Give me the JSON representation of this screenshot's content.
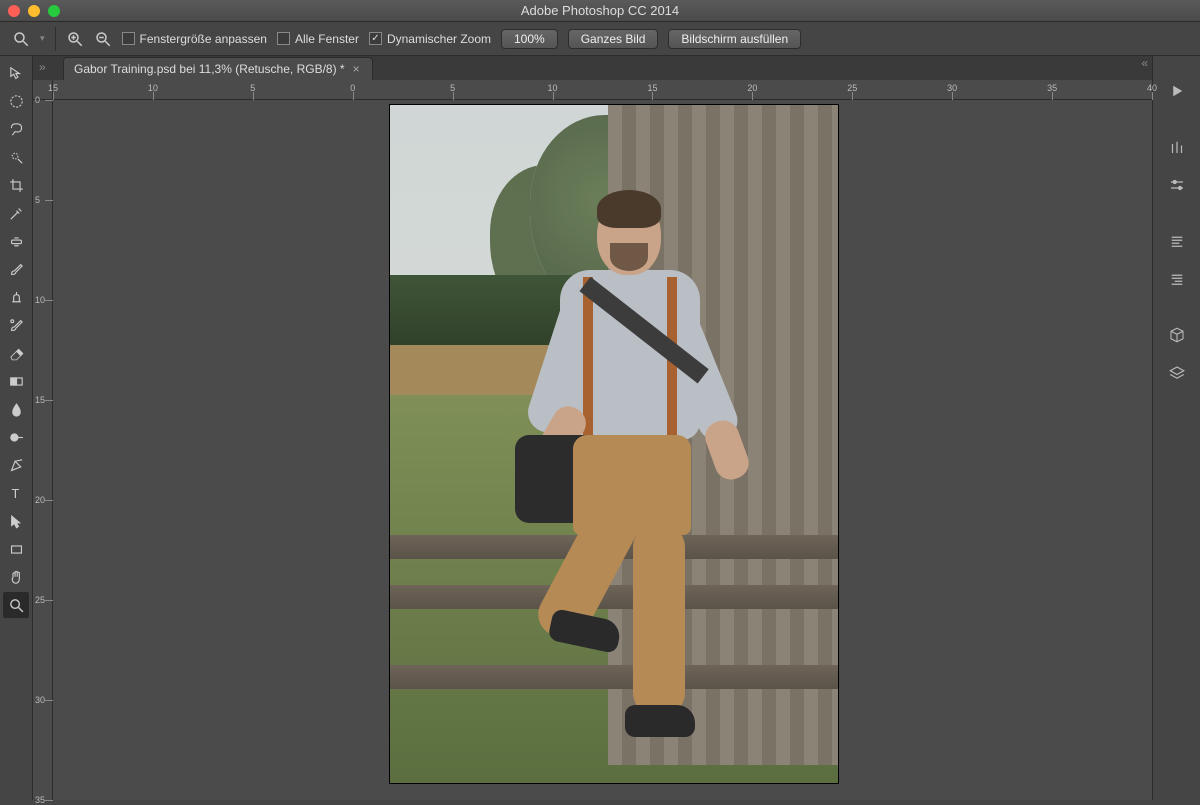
{
  "app_title": "Adobe Photoshop CC 2014",
  "optbar": {
    "fit_window": "Fenstergröße anpassen",
    "all_windows": "Alle Fenster",
    "dynamic_zoom": "Dynamischer Zoom",
    "dynamic_zoom_checked": true,
    "zoom_level": "100%",
    "whole_image": "Ganzes Bild",
    "fill_screen": "Bildschirm ausfüllen"
  },
  "document": {
    "tab_label": "Gabor Training.psd bei 11,3% (Retusche, RGB/8) *"
  },
  "rulers": {
    "h": [
      "15",
      "10",
      "5",
      "0",
      "5",
      "10",
      "15",
      "20",
      "25",
      "30",
      "35",
      "40"
    ],
    "v": [
      "0",
      "5",
      "10",
      "15",
      "20",
      "25",
      "30",
      "35"
    ]
  },
  "tools": [
    {
      "name": "move-tool"
    },
    {
      "name": "marquee-tool"
    },
    {
      "name": "lasso-tool"
    },
    {
      "name": "quick-select-tool"
    },
    {
      "name": "crop-tool"
    },
    {
      "name": "eyedropper-tool"
    },
    {
      "name": "healing-brush-tool"
    },
    {
      "name": "brush-tool"
    },
    {
      "name": "clone-stamp-tool"
    },
    {
      "name": "history-brush-tool"
    },
    {
      "name": "eraser-tool"
    },
    {
      "name": "gradient-tool"
    },
    {
      "name": "blur-tool"
    },
    {
      "name": "dodge-tool"
    },
    {
      "name": "pen-tool"
    },
    {
      "name": "type-tool"
    },
    {
      "name": "path-select-tool"
    },
    {
      "name": "rectangle-tool"
    },
    {
      "name": "hand-tool"
    },
    {
      "name": "zoom-tool",
      "active": true
    }
  ],
  "panels": [
    {
      "name": "play-actions-icon"
    },
    {
      "name": "brushes-icon"
    },
    {
      "name": "adjustments-icon"
    },
    {
      "name": "paragraph-icon"
    },
    {
      "name": "character-icon"
    },
    {
      "name": "3d-icon"
    },
    {
      "name": "layers-icon"
    }
  ]
}
